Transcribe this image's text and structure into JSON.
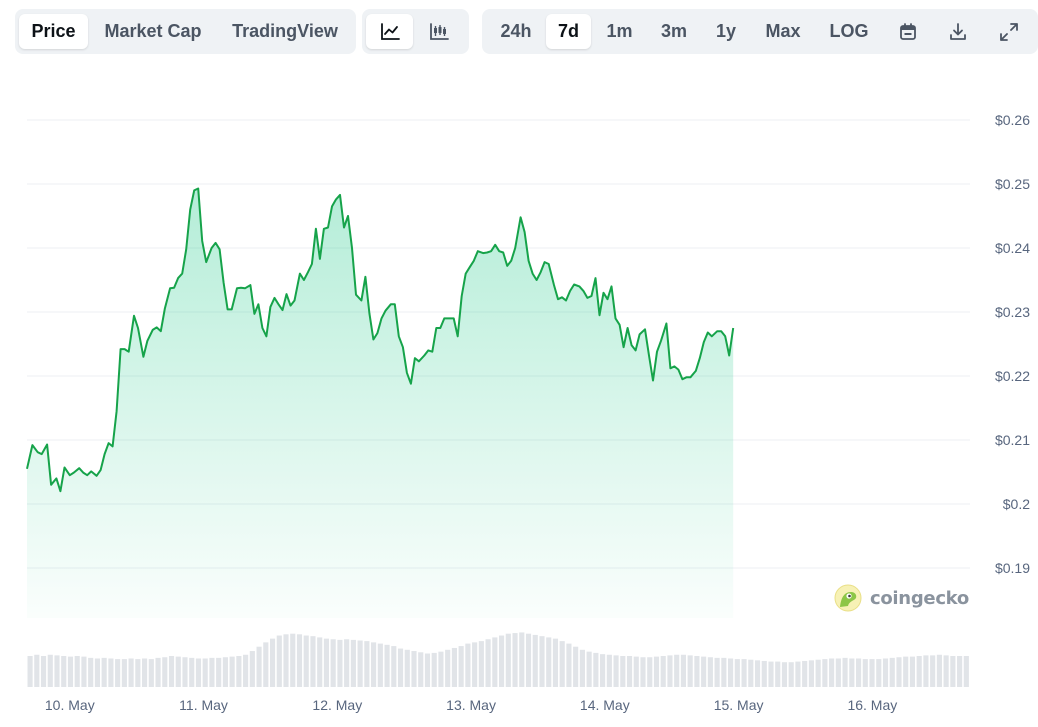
{
  "toolbar": {
    "metric_tabs": [
      {
        "label": "Price",
        "active": true
      },
      {
        "label": "Market Cap",
        "active": false
      },
      {
        "label": "TradingView",
        "active": false
      }
    ],
    "chart_type_buttons": [
      {
        "icon": "line-chart-icon",
        "active": true
      },
      {
        "icon": "candlestick-chart-icon",
        "active": false
      }
    ],
    "range_tabs": [
      {
        "label": "24h",
        "active": false
      },
      {
        "label": "7d",
        "active": true
      },
      {
        "label": "1m",
        "active": false
      },
      {
        "label": "3m",
        "active": false
      },
      {
        "label": "1y",
        "active": false
      },
      {
        "label": "Max",
        "active": false
      },
      {
        "label": "LOG",
        "active": false
      }
    ],
    "tool_icons": [
      "calendar-icon",
      "download-icon",
      "expand-icon"
    ]
  },
  "watermark": {
    "text": "coingecko",
    "icon": "coingecko-logo-icon"
  },
  "colors": {
    "line": "#16a34a",
    "fill_top": "#16c784",
    "grid": "#eceff3",
    "volume": "#e1e4e8",
    "toolbar_bg": "#eff2f5"
  },
  "chart_data": {
    "type": "area",
    "title": "",
    "xlabel": "",
    "ylabel": "",
    "x_range": [
      9.68,
      16.73
    ],
    "ylim": [
      0.19,
      0.26
    ],
    "y_ticks": [
      0.19,
      0.2,
      0.21,
      0.22,
      0.23,
      0.24,
      0.25,
      0.26
    ],
    "y_tick_labels": [
      "$0.19",
      "$0.2",
      "$0.21",
      "$0.22",
      "$0.23",
      "$0.24",
      "$0.25",
      "$0.26"
    ],
    "x_ticks": [
      10,
      11,
      12,
      13,
      14,
      15,
      16
    ],
    "x_tick_labels": [
      "10. May",
      "11. May",
      "12. May",
      "13. May",
      "14. May",
      "15. May",
      "16. May"
    ],
    "grid": true,
    "legend": "none",
    "series": [
      {
        "values": [
          [
            9.68,
            0.2055
          ],
          [
            9.72,
            0.2092
          ],
          [
            9.76,
            0.2081
          ],
          [
            9.79,
            0.2078
          ],
          [
            9.83,
            0.2093
          ],
          [
            9.86,
            0.203
          ],
          [
            9.9,
            0.204
          ],
          [
            9.93,
            0.202
          ],
          [
            9.96,
            0.2057
          ],
          [
            10.0,
            0.2045
          ],
          [
            10.03,
            0.2049
          ],
          [
            10.07,
            0.2056
          ],
          [
            10.1,
            0.2049
          ],
          [
            10.13,
            0.2045
          ],
          [
            10.16,
            0.2051
          ],
          [
            10.2,
            0.2044
          ],
          [
            10.23,
            0.2053
          ],
          [
            10.26,
            0.2078
          ],
          [
            10.29,
            0.2095
          ],
          [
            10.32,
            0.209
          ],
          [
            10.35,
            0.2145
          ],
          [
            10.38,
            0.2242
          ],
          [
            10.41,
            0.2242
          ],
          [
            10.44,
            0.2238
          ],
          [
            10.48,
            0.2294
          ],
          [
            10.51,
            0.2275
          ],
          [
            10.55,
            0.223
          ],
          [
            10.58,
            0.2255
          ],
          [
            10.62,
            0.2272
          ],
          [
            10.65,
            0.2276
          ],
          [
            10.68,
            0.227
          ],
          [
            10.71,
            0.2305
          ],
          [
            10.75,
            0.2337
          ],
          [
            10.78,
            0.2338
          ],
          [
            10.81,
            0.2353
          ],
          [
            10.84,
            0.236
          ],
          [
            10.87,
            0.2398
          ],
          [
            10.9,
            0.246
          ],
          [
            10.93,
            0.249
          ],
          [
            10.96,
            0.2493
          ],
          [
            10.99,
            0.2411
          ],
          [
            11.02,
            0.2378
          ],
          [
            11.06,
            0.24
          ],
          [
            11.09,
            0.2408
          ],
          [
            11.12,
            0.2398
          ],
          [
            11.15,
            0.2346
          ],
          [
            11.18,
            0.2304
          ],
          [
            11.21,
            0.2304
          ],
          [
            11.25,
            0.2337
          ],
          [
            11.28,
            0.2338
          ],
          [
            11.31,
            0.2337
          ],
          [
            11.35,
            0.2342
          ],
          [
            11.38,
            0.2297
          ],
          [
            11.41,
            0.2312
          ],
          [
            11.44,
            0.2275
          ],
          [
            11.47,
            0.2262
          ],
          [
            11.5,
            0.2308
          ],
          [
            11.53,
            0.2322
          ],
          [
            11.56,
            0.2312
          ],
          [
            11.59,
            0.2303
          ],
          [
            11.62,
            0.2328
          ],
          [
            11.65,
            0.231
          ],
          [
            11.68,
            0.2318
          ],
          [
            11.72,
            0.236
          ],
          [
            11.75,
            0.235
          ],
          [
            11.78,
            0.2362
          ],
          [
            11.81,
            0.2375
          ],
          [
            11.84,
            0.243
          ],
          [
            11.87,
            0.2383
          ],
          [
            11.9,
            0.243
          ],
          [
            11.93,
            0.2432
          ],
          [
            11.96,
            0.2465
          ],
          [
            11.99,
            0.2476
          ],
          [
            12.02,
            0.2483
          ],
          [
            12.05,
            0.2432
          ],
          [
            12.08,
            0.245
          ],
          [
            12.11,
            0.24
          ],
          [
            12.14,
            0.2327
          ],
          [
            12.18,
            0.2318
          ],
          [
            12.21,
            0.2355
          ],
          [
            12.24,
            0.2298
          ],
          [
            12.27,
            0.2257
          ],
          [
            12.3,
            0.2267
          ],
          [
            12.33,
            0.229
          ],
          [
            12.36,
            0.2302
          ],
          [
            12.4,
            0.2312
          ],
          [
            12.43,
            0.2312
          ],
          [
            12.46,
            0.2262
          ],
          [
            12.49,
            0.2245
          ],
          [
            12.52,
            0.2205
          ],
          [
            12.55,
            0.2188
          ],
          [
            12.58,
            0.2228
          ],
          [
            12.61,
            0.2223
          ],
          [
            12.65,
            0.2232
          ],
          [
            12.68,
            0.224
          ],
          [
            12.71,
            0.2238
          ],
          [
            12.74,
            0.2275
          ],
          [
            12.77,
            0.2275
          ],
          [
            12.8,
            0.229
          ],
          [
            12.83,
            0.229
          ],
          [
            12.87,
            0.229
          ],
          [
            12.9,
            0.2262
          ],
          [
            12.93,
            0.2325
          ],
          [
            12.96,
            0.236
          ],
          [
            12.99,
            0.237
          ],
          [
            13.02,
            0.238
          ],
          [
            13.05,
            0.2395
          ],
          [
            13.09,
            0.2392
          ],
          [
            13.12,
            0.2393
          ],
          [
            13.15,
            0.2395
          ],
          [
            13.18,
            0.2405
          ],
          [
            13.21,
            0.2395
          ],
          [
            13.24,
            0.2393
          ],
          [
            13.27,
            0.2372
          ],
          [
            13.3,
            0.238
          ],
          [
            13.33,
            0.24
          ],
          [
            13.37,
            0.2448
          ],
          [
            13.4,
            0.2425
          ],
          [
            13.43,
            0.238
          ],
          [
            13.46,
            0.236
          ],
          [
            13.49,
            0.235
          ],
          [
            13.52,
            0.2362
          ],
          [
            13.55,
            0.2378
          ],
          [
            13.58,
            0.2375
          ],
          [
            13.62,
            0.2342
          ],
          [
            13.65,
            0.232
          ],
          [
            13.68,
            0.2323
          ],
          [
            13.71,
            0.2318
          ],
          [
            13.74,
            0.2333
          ],
          [
            13.77,
            0.2343
          ],
          [
            13.81,
            0.234
          ],
          [
            13.84,
            0.2333
          ],
          [
            13.87,
            0.2322
          ],
          [
            13.9,
            0.2325
          ],
          [
            13.93,
            0.2353
          ],
          [
            13.96,
            0.2295
          ],
          [
            13.99,
            0.233
          ],
          [
            14.02,
            0.232
          ],
          [
            14.05,
            0.234
          ],
          [
            14.08,
            0.229
          ],
          [
            14.11,
            0.228
          ],
          [
            14.14,
            0.2245
          ],
          [
            14.17,
            0.2275
          ],
          [
            14.2,
            0.2248
          ],
          [
            14.23,
            0.224
          ],
          [
            14.26,
            0.2265
          ],
          [
            14.3,
            0.2273
          ],
          [
            14.33,
            0.2232
          ],
          [
            14.36,
            0.2193
          ],
          [
            14.39,
            0.2238
          ],
          [
            14.42,
            0.2255
          ],
          [
            14.46,
            0.2282
          ],
          [
            14.49,
            0.2212
          ],
          [
            14.52,
            0.2215
          ],
          [
            14.55,
            0.221
          ],
          [
            14.58,
            0.2195
          ],
          [
            14.61,
            0.2198
          ],
          [
            14.64,
            0.2198
          ],
          [
            14.68,
            0.2208
          ],
          [
            14.71,
            0.2228
          ],
          [
            14.74,
            0.2253
          ],
          [
            14.77,
            0.2268
          ],
          [
            14.8,
            0.2262
          ],
          [
            14.84,
            0.227
          ],
          [
            14.87,
            0.227
          ],
          [
            14.9,
            0.2262
          ],
          [
            14.93,
            0.2232
          ],
          [
            14.96,
            0.2275
          ]
        ]
      }
    ],
    "volume": [
      0.5,
      0.52,
      0.5,
      0.52,
      0.51,
      0.5,
      0.49,
      0.5,
      0.49,
      0.47,
      0.46,
      0.47,
      0.46,
      0.45,
      0.45,
      0.46,
      0.45,
      0.46,
      0.45,
      0.47,
      0.48,
      0.5,
      0.49,
      0.48,
      0.47,
      0.46,
      0.46,
      0.47,
      0.47,
      0.48,
      0.49,
      0.5,
      0.52,
      0.58,
      0.65,
      0.72,
      0.78,
      0.83,
      0.85,
      0.86,
      0.85,
      0.83,
      0.82,
      0.8,
      0.78,
      0.77,
      0.76,
      0.77,
      0.76,
      0.75,
      0.74,
      0.72,
      0.7,
      0.68,
      0.66,
      0.62,
      0.6,
      0.58,
      0.56,
      0.54,
      0.55,
      0.57,
      0.6,
      0.63,
      0.66,
      0.7,
      0.72,
      0.74,
      0.77,
      0.8,
      0.83,
      0.86,
      0.87,
      0.88,
      0.86,
      0.84,
      0.82,
      0.8,
      0.78,
      0.74,
      0.7,
      0.65,
      0.6,
      0.57,
      0.55,
      0.53,
      0.52,
      0.51,
      0.5,
      0.5,
      0.49,
      0.48,
      0.48,
      0.49,
      0.5,
      0.51,
      0.52,
      0.52,
      0.51,
      0.5,
      0.49,
      0.48,
      0.47,
      0.47,
      0.46,
      0.45,
      0.45,
      0.44,
      0.43,
      0.42,
      0.41,
      0.41,
      0.4,
      0.4,
      0.41,
      0.42,
      0.43,
      0.44,
      0.45,
      0.46,
      0.46,
      0.47,
      0.46,
      0.46,
      0.45,
      0.45,
      0.45,
      0.46,
      0.47,
      0.48,
      0.49,
      0.49,
      0.5,
      0.51,
      0.51,
      0.52,
      0.51,
      0.5,
      0.5,
      0.5
    ]
  }
}
